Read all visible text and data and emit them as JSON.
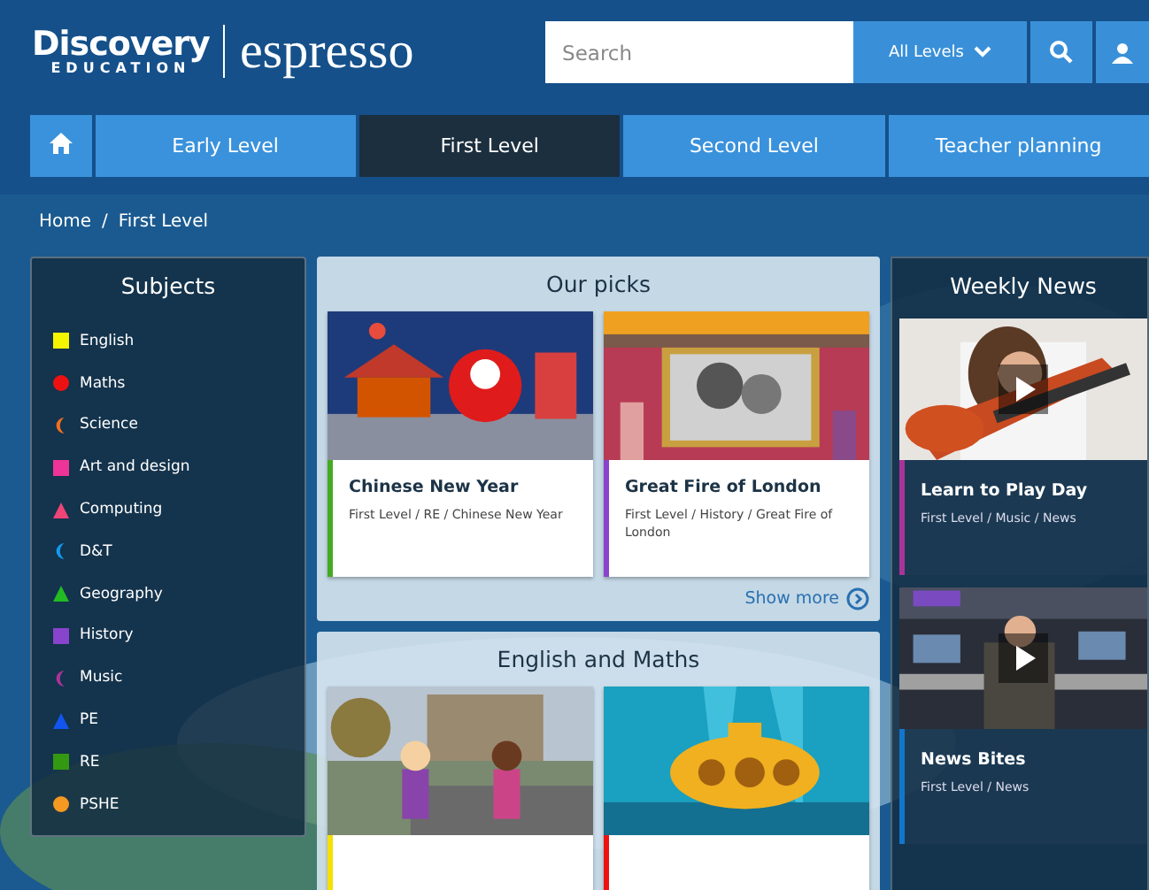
{
  "header": {
    "logo": {
      "brand": "Discovery",
      "sub": "EDUCATION",
      "product": "espresso"
    },
    "search": {
      "placeholder": "Search"
    },
    "level_menu": "All Levels"
  },
  "nav": {
    "tabs": [
      {
        "label": "Early Level",
        "selected": false
      },
      {
        "label": "First Level",
        "selected": true
      },
      {
        "label": "Second Level",
        "selected": false
      },
      {
        "label": "Teacher planning",
        "selected": false
      }
    ]
  },
  "breadcrumb": {
    "items": [
      "Home",
      "First Level"
    ],
    "separator": "/"
  },
  "subjects": {
    "title": "Subjects",
    "items": [
      {
        "label": "English",
        "kind": "square",
        "color": "#f5f500"
      },
      {
        "label": "Maths",
        "kind": "circle",
        "color": "#ee1111"
      },
      {
        "label": "Science",
        "kind": "crescent",
        "color": "#f07020"
      },
      {
        "label": "Art and design",
        "kind": "square",
        "color": "#ee3399"
      },
      {
        "label": "Computing",
        "kind": "triangle",
        "color": "#ee4477"
      },
      {
        "label": "D&T",
        "kind": "crescent",
        "color": "#1199ee"
      },
      {
        "label": "Geography",
        "kind": "triangle",
        "color": "#22bb22"
      },
      {
        "label": "History",
        "kind": "square",
        "color": "#8844cc"
      },
      {
        "label": "Music",
        "kind": "crescent",
        "color": "#aa3399"
      },
      {
        "label": "PE",
        "kind": "triangle",
        "color": "#1155ee"
      },
      {
        "label": "RE",
        "kind": "square",
        "color": "#339911"
      },
      {
        "label": "PSHE",
        "kind": "circle",
        "color": "#f59922"
      }
    ]
  },
  "our_picks": {
    "title": "Our picks",
    "cards": [
      {
        "title": "Chinese New Year",
        "path": "First Level / RE / Chinese New Year",
        "color": "#44aa22",
        "kind": "picture"
      },
      {
        "title": "Great Fire of London",
        "path": "First Level / History / Great Fire of London",
        "color": "#8844cc",
        "kind": "picture"
      }
    ],
    "more": "Show more"
  },
  "english_maths": {
    "title": "English and Maths"
  },
  "weekly_news": {
    "title": "Weekly News",
    "cards": [
      {
        "title": "Learn to Play Day",
        "path": "First Level / Music / News",
        "color": "#aa3399",
        "kind": "picture"
      },
      {
        "title": "News Bites",
        "path": "First Level / News",
        "color": "#1177cc",
        "kind": "picture"
      }
    ]
  }
}
